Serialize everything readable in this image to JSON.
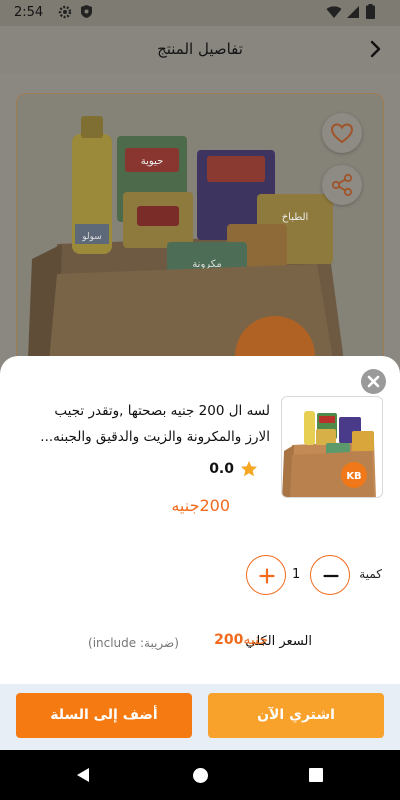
{
  "status_bar": {
    "time": "2:54"
  },
  "header": {
    "title": "تفاصيل المنتج"
  },
  "bundle_image": {
    "brand_labels": [
      "حيوية",
      "الطباخ",
      "مكرونة",
      "سولو",
      "KB"
    ]
  },
  "product": {
    "description_line1": "لسه ال 200 جنيه بصحتها ,وتقدر تجيب",
    "description_line2": "الارز والمكرونة والزيت والدقيق والجبنه...",
    "rating": "0.0",
    "price": "200جنيه"
  },
  "quantity": {
    "label": "كمية",
    "value": "1"
  },
  "total": {
    "label": "السعر الكلي",
    "amount": "200",
    "currency": "جنيه",
    "tax_note": "(ضريبة: include)"
  },
  "actions": {
    "buy_now": "اشتري الآن",
    "add_to_cart": "أضف إلى السلة"
  },
  "colors": {
    "accent": "#f26b1d",
    "buy_button": "#f8a22c",
    "cart_button": "#f57a12",
    "star": "#f5a623"
  }
}
